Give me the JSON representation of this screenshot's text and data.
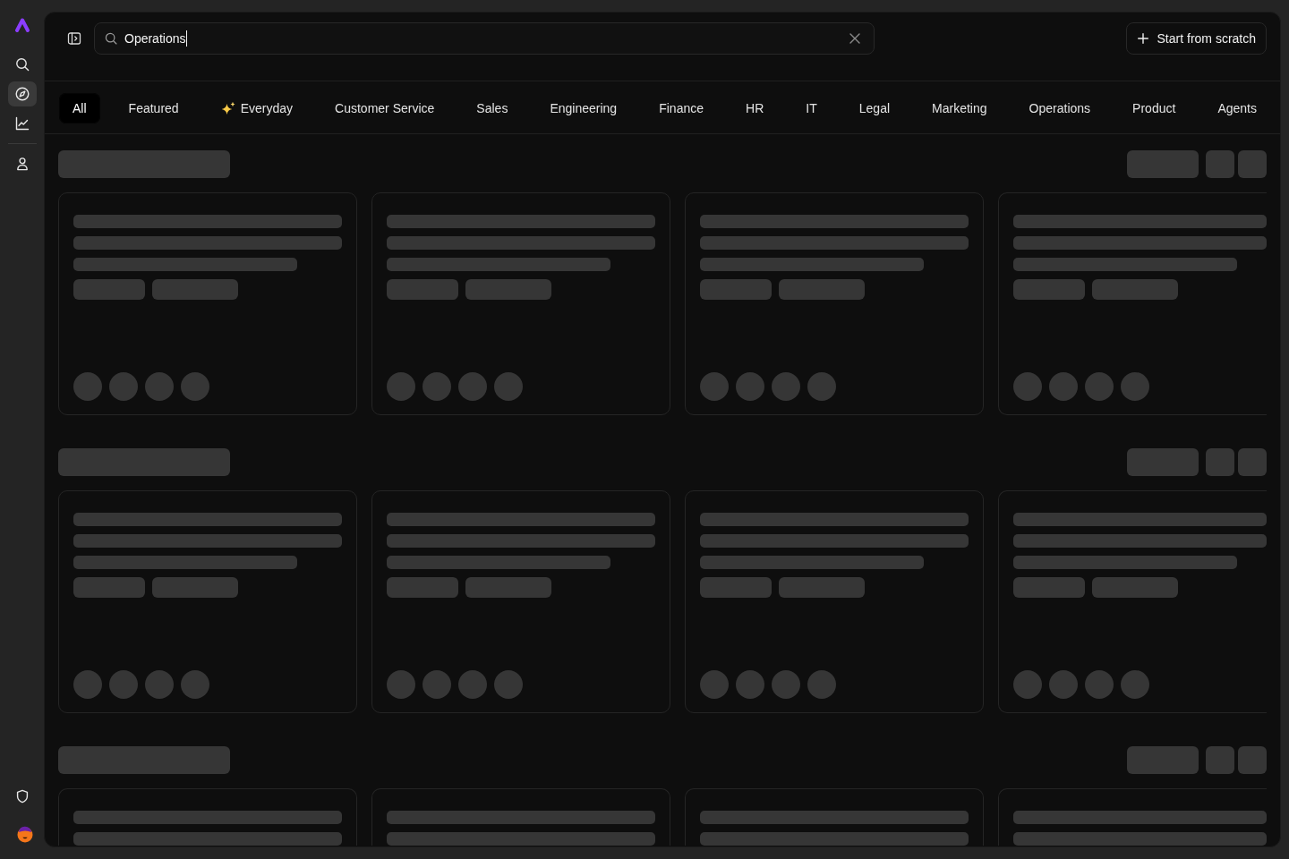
{
  "sidebar": {
    "main_items": [
      {
        "kind": "search",
        "selected": false
      },
      {
        "kind": "explore",
        "selected": true
      },
      {
        "kind": "analytics",
        "selected": false
      }
    ],
    "secondary_items": [
      {
        "kind": "people",
        "selected": false
      }
    ],
    "bottom_items": [
      {
        "kind": "security",
        "selected": false
      }
    ]
  },
  "header": {
    "search": {
      "value": "Operations",
      "focused": true
    },
    "action_button": "Start from scratch"
  },
  "tabs": [
    {
      "label": "All",
      "selected": true,
      "kind": "text"
    },
    {
      "label": "Featured",
      "selected": false,
      "kind": "text"
    },
    {
      "label": "Everyday",
      "selected": false,
      "kind": "emoji"
    },
    {
      "label": "Customer Service",
      "selected": false,
      "kind": "text"
    },
    {
      "label": "Sales",
      "selected": false,
      "kind": "text"
    },
    {
      "label": "Engineering",
      "selected": false,
      "kind": "text"
    },
    {
      "label": "Finance",
      "selected": false,
      "kind": "text"
    },
    {
      "label": "HR",
      "selected": false,
      "kind": "text"
    },
    {
      "label": "IT",
      "selected": false,
      "kind": "text"
    },
    {
      "label": "Legal",
      "selected": false,
      "kind": "text"
    },
    {
      "label": "Marketing",
      "selected": false,
      "kind": "text"
    },
    {
      "label": "Operations",
      "selected": false,
      "kind": "text"
    },
    {
      "label": "Product",
      "selected": false,
      "kind": "text"
    },
    {
      "label": "Agents",
      "selected": false,
      "kind": "text"
    }
  ],
  "content": {
    "loading": true
  }
}
